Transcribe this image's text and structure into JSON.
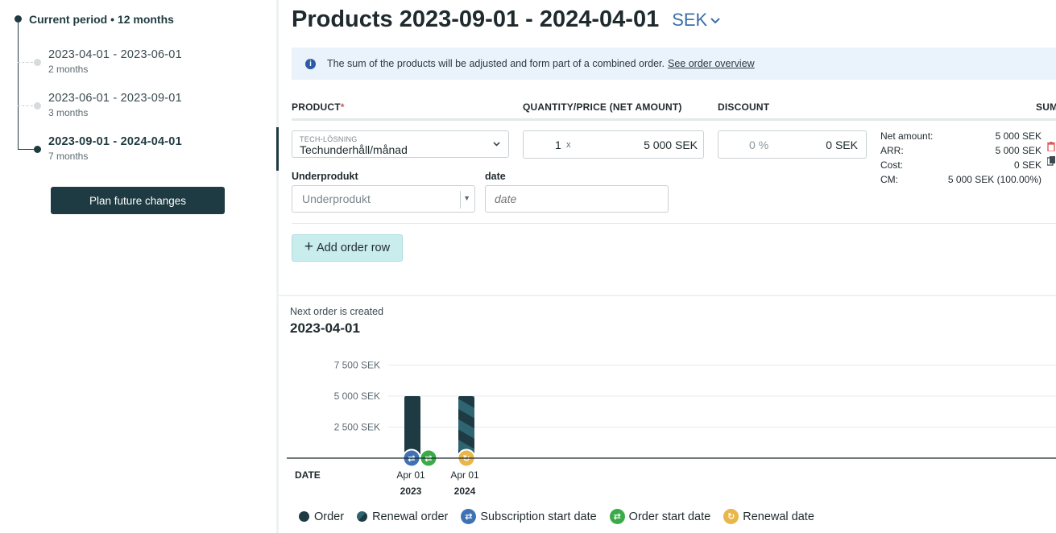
{
  "sidebar": {
    "current_period": "Current period • 12 months",
    "periods": [
      {
        "range": "2023-04-01 - 2023-06-01",
        "duration": "2 months"
      },
      {
        "range": "2023-06-01 - 2023-09-01",
        "duration": "3 months"
      },
      {
        "range": "2023-09-01 - 2024-04-01",
        "duration": "7 months"
      }
    ],
    "plan_button": "Plan future changes"
  },
  "header": {
    "title": "Products 2023-09-01 - 2024-04-01",
    "currency": "SEK"
  },
  "info": {
    "text": "The sum of the products will be adjusted and form part of a combined order.",
    "link": "See order overview"
  },
  "columns": {
    "product": "PRODUCT",
    "required_mark": "*",
    "quantity_price": "QUANTITY/PRICE (NET AMOUNT)",
    "discount": "DISCOUNT",
    "sum": "SUM"
  },
  "row": {
    "product_category": "TECH-LÖSNING",
    "product_value": "Techunderhåll/månad",
    "quantity": "1",
    "times": "x",
    "price": "5 000 SEK",
    "discount_pct": "0",
    "discount_pct_unit": "%",
    "discount_amount": "0 SEK",
    "summary": [
      {
        "label": "Net amount:",
        "value": "5 000 SEK"
      },
      {
        "label": "ARR:",
        "value": "5 000 SEK"
      },
      {
        "label": "Cost:",
        "value": "0 SEK"
      },
      {
        "label": "CM:",
        "value": "5 000 SEK (100.00%)"
      }
    ],
    "subproduct_label": "Underprodukt",
    "subproduct_placeholder": "Underprodukt",
    "date_label": "date",
    "date_placeholder": "date"
  },
  "add_row_button": "Add order row",
  "next_order": {
    "label": "Next order is created",
    "date": "2023-04-01"
  },
  "colors": {
    "order": "#1e3a42",
    "renewal": "#2b5560",
    "subscription_start": "#3f72b5",
    "order_start": "#3bab4a",
    "renewal_date": "#e8b64a"
  },
  "chart_data": {
    "type": "bar",
    "yticks": [
      "7 500 SEK",
      "5 000 SEK",
      "2 500 SEK"
    ],
    "ytick_values": [
      7500,
      5000,
      2500
    ],
    "ylim": [
      0,
      10000
    ],
    "xlabel": "DATE",
    "bars": [
      {
        "x_label": "Apr 01",
        "year": "2023",
        "value": 5000,
        "kind": "order",
        "markers": [
          "subscription_start",
          "order_start"
        ]
      },
      {
        "x_label": "Apr 01",
        "year": "2024",
        "value": 5000,
        "kind": "renewal",
        "markers": [
          "renewal_date"
        ]
      }
    ],
    "legend": [
      {
        "label": "Order",
        "type": "dot",
        "color": "#1e3a42"
      },
      {
        "label": "Renewal order",
        "type": "dot-striped",
        "color": "#2b5560"
      },
      {
        "label": "Subscription start date",
        "type": "icon",
        "color": "#3f72b5"
      },
      {
        "label": "Order start date",
        "type": "icon",
        "color": "#3bab4a"
      },
      {
        "label": "Renewal date",
        "type": "icon",
        "color": "#e8b64a"
      }
    ]
  }
}
